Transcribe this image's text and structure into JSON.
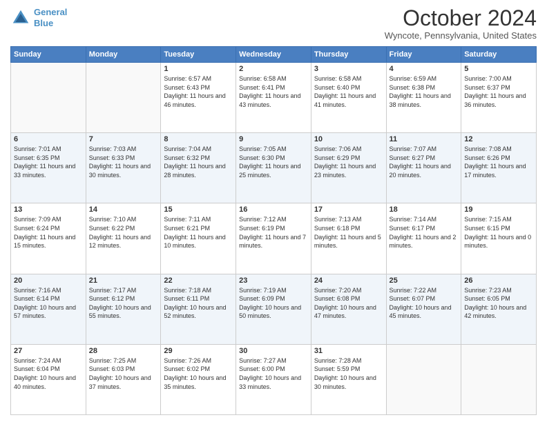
{
  "header": {
    "logo_line1": "General",
    "logo_line2": "Blue",
    "month_title": "October 2024",
    "location": "Wyncote, Pennsylvania, United States"
  },
  "days_of_week": [
    "Sunday",
    "Monday",
    "Tuesday",
    "Wednesday",
    "Thursday",
    "Friday",
    "Saturday"
  ],
  "weeks": [
    [
      {
        "day": "",
        "info": ""
      },
      {
        "day": "",
        "info": ""
      },
      {
        "day": "1",
        "info": "Sunrise: 6:57 AM\nSunset: 6:43 PM\nDaylight: 11 hours and 46 minutes."
      },
      {
        "day": "2",
        "info": "Sunrise: 6:58 AM\nSunset: 6:41 PM\nDaylight: 11 hours and 43 minutes."
      },
      {
        "day": "3",
        "info": "Sunrise: 6:58 AM\nSunset: 6:40 PM\nDaylight: 11 hours and 41 minutes."
      },
      {
        "day": "4",
        "info": "Sunrise: 6:59 AM\nSunset: 6:38 PM\nDaylight: 11 hours and 38 minutes."
      },
      {
        "day": "5",
        "info": "Sunrise: 7:00 AM\nSunset: 6:37 PM\nDaylight: 11 hours and 36 minutes."
      }
    ],
    [
      {
        "day": "6",
        "info": "Sunrise: 7:01 AM\nSunset: 6:35 PM\nDaylight: 11 hours and 33 minutes."
      },
      {
        "day": "7",
        "info": "Sunrise: 7:03 AM\nSunset: 6:33 PM\nDaylight: 11 hours and 30 minutes."
      },
      {
        "day": "8",
        "info": "Sunrise: 7:04 AM\nSunset: 6:32 PM\nDaylight: 11 hours and 28 minutes."
      },
      {
        "day": "9",
        "info": "Sunrise: 7:05 AM\nSunset: 6:30 PM\nDaylight: 11 hours and 25 minutes."
      },
      {
        "day": "10",
        "info": "Sunrise: 7:06 AM\nSunset: 6:29 PM\nDaylight: 11 hours and 23 minutes."
      },
      {
        "day": "11",
        "info": "Sunrise: 7:07 AM\nSunset: 6:27 PM\nDaylight: 11 hours and 20 minutes."
      },
      {
        "day": "12",
        "info": "Sunrise: 7:08 AM\nSunset: 6:26 PM\nDaylight: 11 hours and 17 minutes."
      }
    ],
    [
      {
        "day": "13",
        "info": "Sunrise: 7:09 AM\nSunset: 6:24 PM\nDaylight: 11 hours and 15 minutes."
      },
      {
        "day": "14",
        "info": "Sunrise: 7:10 AM\nSunset: 6:22 PM\nDaylight: 11 hours and 12 minutes."
      },
      {
        "day": "15",
        "info": "Sunrise: 7:11 AM\nSunset: 6:21 PM\nDaylight: 11 hours and 10 minutes."
      },
      {
        "day": "16",
        "info": "Sunrise: 7:12 AM\nSunset: 6:19 PM\nDaylight: 11 hours and 7 minutes."
      },
      {
        "day": "17",
        "info": "Sunrise: 7:13 AM\nSunset: 6:18 PM\nDaylight: 11 hours and 5 minutes."
      },
      {
        "day": "18",
        "info": "Sunrise: 7:14 AM\nSunset: 6:17 PM\nDaylight: 11 hours and 2 minutes."
      },
      {
        "day": "19",
        "info": "Sunrise: 7:15 AM\nSunset: 6:15 PM\nDaylight: 11 hours and 0 minutes."
      }
    ],
    [
      {
        "day": "20",
        "info": "Sunrise: 7:16 AM\nSunset: 6:14 PM\nDaylight: 10 hours and 57 minutes."
      },
      {
        "day": "21",
        "info": "Sunrise: 7:17 AM\nSunset: 6:12 PM\nDaylight: 10 hours and 55 minutes."
      },
      {
        "day": "22",
        "info": "Sunrise: 7:18 AM\nSunset: 6:11 PM\nDaylight: 10 hours and 52 minutes."
      },
      {
        "day": "23",
        "info": "Sunrise: 7:19 AM\nSunset: 6:09 PM\nDaylight: 10 hours and 50 minutes."
      },
      {
        "day": "24",
        "info": "Sunrise: 7:20 AM\nSunset: 6:08 PM\nDaylight: 10 hours and 47 minutes."
      },
      {
        "day": "25",
        "info": "Sunrise: 7:22 AM\nSunset: 6:07 PM\nDaylight: 10 hours and 45 minutes."
      },
      {
        "day": "26",
        "info": "Sunrise: 7:23 AM\nSunset: 6:05 PM\nDaylight: 10 hours and 42 minutes."
      }
    ],
    [
      {
        "day": "27",
        "info": "Sunrise: 7:24 AM\nSunset: 6:04 PM\nDaylight: 10 hours and 40 minutes."
      },
      {
        "day": "28",
        "info": "Sunrise: 7:25 AM\nSunset: 6:03 PM\nDaylight: 10 hours and 37 minutes."
      },
      {
        "day": "29",
        "info": "Sunrise: 7:26 AM\nSunset: 6:02 PM\nDaylight: 10 hours and 35 minutes."
      },
      {
        "day": "30",
        "info": "Sunrise: 7:27 AM\nSunset: 6:00 PM\nDaylight: 10 hours and 33 minutes."
      },
      {
        "day": "31",
        "info": "Sunrise: 7:28 AM\nSunset: 5:59 PM\nDaylight: 10 hours and 30 minutes."
      },
      {
        "day": "",
        "info": ""
      },
      {
        "day": "",
        "info": ""
      }
    ]
  ]
}
